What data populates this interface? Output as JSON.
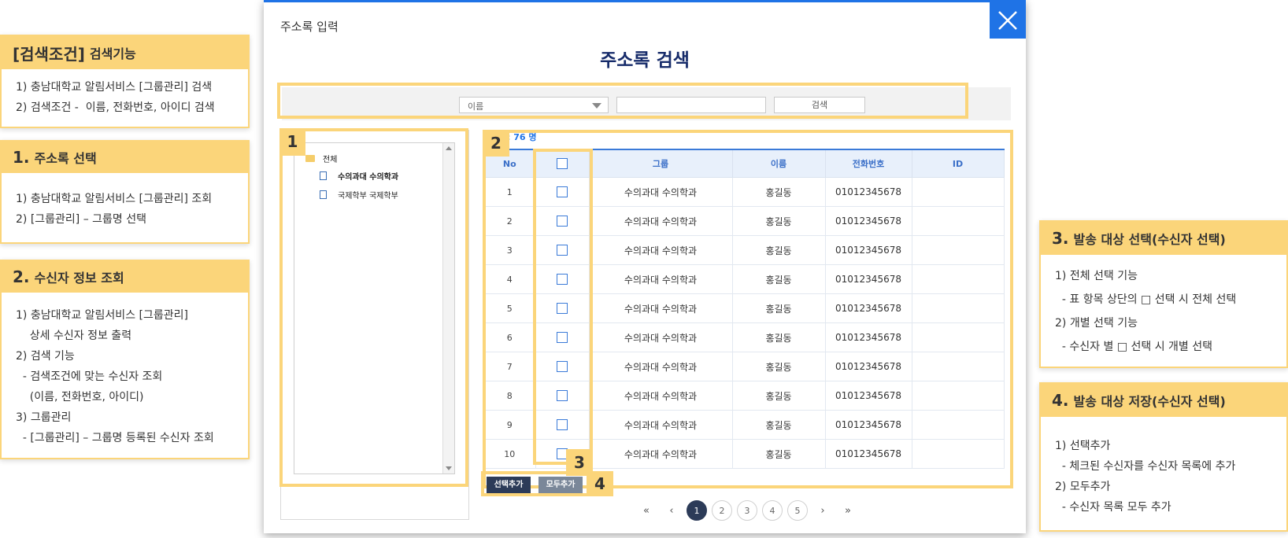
{
  "notes": {
    "search": {
      "num": "[검색조건]",
      "title": "검색기능",
      "lines": [
        "1) 충남대학교 알림서비스 [그룹관리] 검색",
        "2) 검색조건 -  이름, 전화번호, 아이디 검색"
      ]
    },
    "n1": {
      "num": "1.",
      "title": "주소록 선택",
      "lines": [
        "1) 충남대학교 알림서비스 [그룹관리] 조회",
        "2) [그룹관리] – 그룹명 선택"
      ]
    },
    "n2": {
      "num": "2.",
      "title": "수신자 정보 조회",
      "lines": [
        "1) 충남대학교 알림서비스 [그룹관리]",
        "    상세 수신자 정보 출력",
        "2) 검색 기능",
        "  - 검색조건에 맞는 수신자 조회",
        "    (이름, 전화번호, 아이디)",
        "3) 그룹관리",
        "  - [그룹관리] – 그룹명 등록된 수신자 조회"
      ]
    },
    "n3": {
      "num": "3.",
      "title": "발송 대상 선택(수신자 선택)",
      "lines": [
        "1) 전체 선택 기능",
        "  - 표 항목 상단의 □ 선택 시 전체 선택",
        "2) 개별 선택 기능",
        "  - 수신자 별 □ 선택 시 개별 선택"
      ]
    },
    "n4": {
      "num": "4.",
      "title": "발송 대상 저장(수신자 선택)",
      "lines": [
        "1) 선택추가",
        "  - 체크된 수신자를 수신자 목록에 추가",
        "2) 모두추가",
        "  - 수신자 목록 모두 추가"
      ]
    }
  },
  "modal": {
    "title": "주소록 입력",
    "page_title": "주소록 검색",
    "search": {
      "select_value": "이름",
      "input_value": "",
      "button": "검색"
    },
    "tree": {
      "root": "전체",
      "children": [
        "수의과대 수의학과",
        "국제학부 국제학부"
      ]
    },
    "count_text": ": 76 명",
    "table": {
      "headers": [
        "No",
        "",
        "그룹",
        "이름",
        "전화번호",
        "ID"
      ],
      "rows": [
        [
          "1",
          "수의과대 수의학과",
          "홍길동",
          "01012345678",
          ""
        ],
        [
          "2",
          "수의과대 수의학과",
          "홍길동",
          "01012345678",
          ""
        ],
        [
          "3",
          "수의과대 수의학과",
          "홍길동",
          "01012345678",
          ""
        ],
        [
          "4",
          "수의과대 수의학과",
          "홍길동",
          "01012345678",
          ""
        ],
        [
          "5",
          "수의과대 수의학과",
          "홍길동",
          "01012345678",
          ""
        ],
        [
          "6",
          "수의과대 수의학과",
          "홍길동",
          "01012345678",
          ""
        ],
        [
          "7",
          "수의과대 수의학과",
          "홍길동",
          "01012345678",
          ""
        ],
        [
          "8",
          "수의과대 수의학과",
          "홍길동",
          "01012345678",
          ""
        ],
        [
          "9",
          "수의과대 수의학과",
          "홍길동",
          "01012345678",
          ""
        ],
        [
          "10",
          "수의과대 수의학과",
          "홍길동",
          "01012345678",
          ""
        ]
      ]
    },
    "buttons": {
      "add_selected": "선택추가",
      "add_all": "모두추가"
    },
    "markers": [
      "1",
      "2",
      "3",
      "4"
    ],
    "pager": {
      "first": "«",
      "prev": "‹",
      "pages": [
        "1",
        "2",
        "3",
        "4",
        "5"
      ],
      "next": "›",
      "last": "»"
    },
    "accent_color": "#1f73e6",
    "highlight_color": "#fbd57a"
  }
}
